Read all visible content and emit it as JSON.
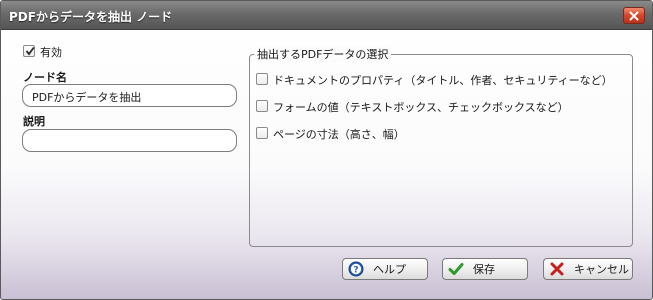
{
  "window": {
    "title": "PDFからデータを抽出 ノード"
  },
  "form": {
    "enabled_label": "有効",
    "enabled_checked": true,
    "node_name_label": "ノード名",
    "node_name_value": "PDFからデータを抽出",
    "description_label": "説明",
    "description_value": ""
  },
  "extract_group": {
    "legend": "抽出するPDFデータの選択",
    "options": [
      {
        "label": "ドキュメントのプロパティ（タイトル、作者、セキュリティーなど）",
        "checked": false
      },
      {
        "label": "フォームの値（テキストボックス、チェックボックスなど）",
        "checked": false
      },
      {
        "label": "ページの寸法（高さ、幅）",
        "checked": false
      }
    ]
  },
  "buttons": {
    "help": "ヘルプ",
    "save": "保存",
    "cancel": "キャンセル"
  },
  "colors": {
    "titlebar": "#6a6a6a",
    "close_button": "#d4452a",
    "save_check": "#2e9a2e",
    "cancel_x": "#c81e1e",
    "help_icon": "#2a5fb0"
  },
  "icons": {
    "close": "close-icon",
    "help": "help-icon",
    "save": "checkmark-icon",
    "cancel": "x-icon"
  }
}
